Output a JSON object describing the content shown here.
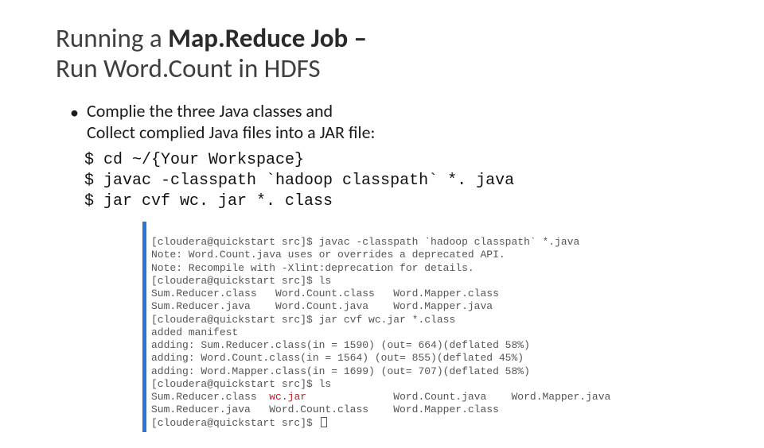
{
  "title": {
    "prefix": "Running a ",
    "bold": "Map.Reduce Job –",
    "line2": "Run Word.Count in HDFS"
  },
  "bullet": {
    "marker": "•",
    "line1": "Complie the three Java classes and",
    "line2": "Collect complied Java files into a JAR file:"
  },
  "cmd": {
    "l1": "$ cd ~/{Your Workspace}",
    "l2": "$ javac -classpath `hadoop classpath` *. java",
    "l3": "$ jar cvf wc. jar *. class"
  },
  "term": {
    "l01": "[cloudera@quickstart src]$ javac -classpath `hadoop classpath` *.java",
    "l02": "Note: Word.Count.java uses or overrides a deprecated API.",
    "l03": "Note: Recompile with -Xlint:deprecation for details.",
    "l04": "[cloudera@quickstart src]$ ls",
    "l05": "Sum.Reducer.class   Word.Count.class   Word.Mapper.class",
    "l06": "Sum.Reducer.java    Word.Count.java    Word.Mapper.java",
    "l07": "[cloudera@quickstart src]$ jar cvf wc.jar *.class",
    "l08": "added manifest",
    "l09": "adding: Sum.Reducer.class(in = 1590) (out= 664)(deflated 58%)",
    "l10": "adding: Word.Count.class(in = 1564) (out= 855)(deflated 45%)",
    "l11": "adding: Word.Mapper.class(in = 1699) (out= 707)(deflated 58%)",
    "l12": "[cloudera@quickstart src]$ ls",
    "l13a": "Sum.Reducer.class  ",
    "l13b": "wc.jar",
    "l13c": "              Word.Count.java    Word.Mapper.java",
    "l14": "Sum.Reducer.java   Word.Count.class    Word.Mapper.class",
    "l15": "[cloudera@quickstart src]$ "
  }
}
